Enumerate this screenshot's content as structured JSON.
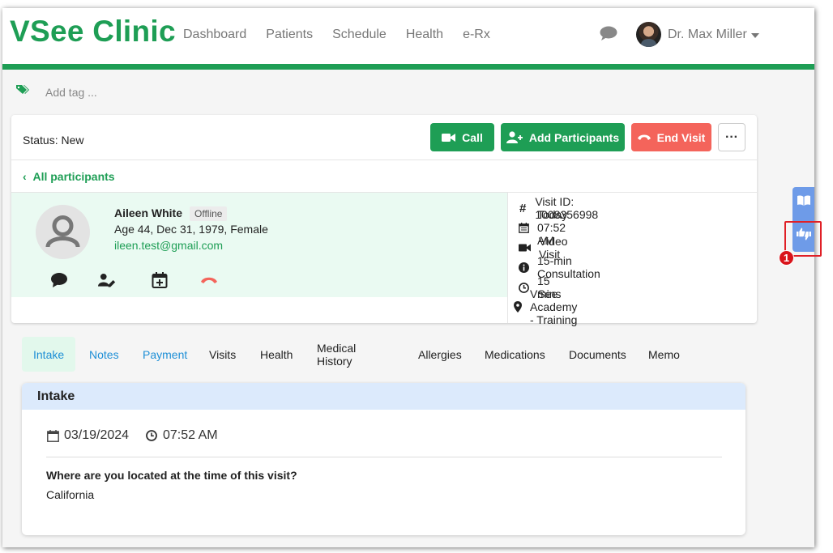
{
  "app": {
    "logo": "VSee Clinic"
  },
  "nav": {
    "items": [
      "Dashboard",
      "Patients",
      "Schedule",
      "Health",
      "e-Rx"
    ]
  },
  "user": {
    "name": "Dr. Max Miller"
  },
  "tags": {
    "placeholder": "Add tag ..."
  },
  "visit": {
    "status": "Status: New",
    "buttons": {
      "call": "Call",
      "add": "Add Participants",
      "end": "End Visit",
      "more": "···"
    },
    "back_link": "All participants",
    "patient": {
      "name": "Aileen White",
      "badge": "Offline",
      "info": "Age 44, Dec 31, 1979, Female",
      "email": "ileen.test@gmail.com"
    },
    "details": [
      {
        "icon": "hash-icon",
        "text": "Visit ID: 1008356998"
      },
      {
        "icon": "calendar-icon",
        "text": "Today 07:52 AM"
      },
      {
        "icon": "video-icon",
        "text": "Video Visit"
      },
      {
        "icon": "info-icon",
        "text": "15-min Consultation"
      },
      {
        "icon": "clock-icon",
        "text": "15 mins"
      },
      {
        "icon": "location-icon",
        "text": "VSee Academy - Training"
      }
    ]
  },
  "tabs": [
    "Intake",
    "Notes",
    "Payment",
    "Visits",
    "Health",
    "Medical History",
    "Allergies",
    "Medications",
    "Documents",
    "Memo"
  ],
  "intake": {
    "title": "Intake",
    "date": "03/19/2024",
    "time": "07:52 AM",
    "question": "Where are you located at the time of this visit?",
    "answer": "California"
  },
  "annotation": {
    "marker": "1"
  },
  "colors": {
    "brand_green": "#1e9e55",
    "end_red": "#f4645b",
    "link_blue": "#1e8fd6",
    "rail_blue": "#6e9be8"
  }
}
